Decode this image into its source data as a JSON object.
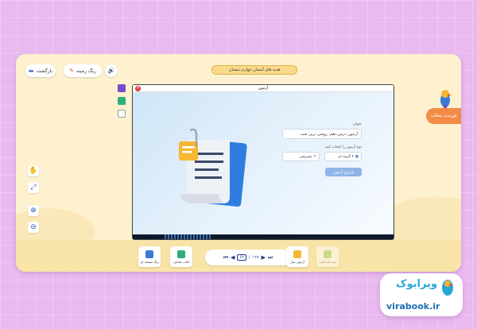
{
  "topbar": {
    "back_label": "بازگشت",
    "bg_color_label": "رنگ زمینه",
    "book_title": "هدیه های آسمان چهارم دبستان"
  },
  "right_tab": {
    "label": "فهرست مطالب"
  },
  "modal": {
    "title": "آزمون",
    "title_label": "عنوان",
    "title_value": "آزمون درس دهم: روشن ترین شب",
    "type_label": "نوع آزمون را انتخاب کنید",
    "option_multiple": "۴ گزینه ای",
    "option_descriptive": "تشریحی",
    "start_label": "شروع آزمون"
  },
  "bottombar": {
    "page_color_label": "رنگ صفحه ای",
    "activity_book_label": "کتاب تعاملی",
    "current_page": "۶۹",
    "total_pages": "۱۲۸",
    "quiz_maker_label": "آزمون ساز",
    "last_label": "ثبت یادداشت"
  },
  "brand": {
    "name_fa": "ویرابوک",
    "name_en": "virabook.ir"
  },
  "colors": {
    "accent_orange": "#f28c45",
    "brand_blue": "#1f6fb5",
    "background": "#e9b9f0"
  },
  "icons": [
    "back-arrow-icon",
    "speaker-icon",
    "paint-icon",
    "folder-icon",
    "book-icon",
    "list-icon",
    "hand-icon",
    "expand-icon",
    "zoom-in-icon",
    "zoom-out-icon",
    "globe-icon",
    "close-icon",
    "document-icon",
    "parrot-icon"
  ]
}
